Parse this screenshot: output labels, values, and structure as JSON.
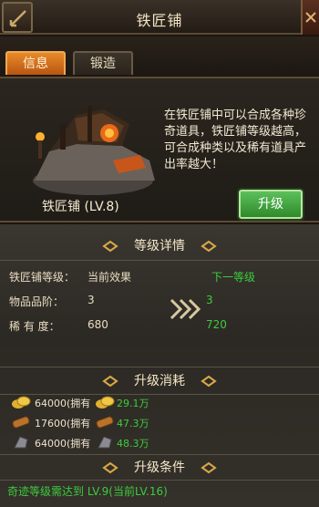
{
  "header": {
    "title": "铁匠铺",
    "back_icon": "back-arrow-icon",
    "close_icon": "close-icon"
  },
  "tabs": [
    {
      "label": "信息",
      "active": true
    },
    {
      "label": "锻造",
      "active": false
    }
  ],
  "building": {
    "name": "铁匠铺 (LV.8)",
    "description": "在铁匠铺中可以合成各种珍奇道具，铁匠铺等级越高，可合成种类以及稀有道具产出率越大！",
    "upgrade_label": "升级"
  },
  "level_details": {
    "heading": "等级详情",
    "level_label": "铁匠铺等级：",
    "current_label": "当前效果",
    "next_label": "下一等级",
    "rows": [
      {
        "label": "物品品阶：",
        "current": "3",
        "next": "3"
      },
      {
        "label": "稀 有 度：",
        "current": "680",
        "next": "720"
      }
    ]
  },
  "upgrade_cost": {
    "heading": "升级消耗",
    "items": [
      {
        "icon": "gold-coin-icon",
        "have": "64000(拥有",
        "need": "29.1万"
      },
      {
        "icon": "wood-log-icon",
        "have": "17600(拥有",
        "need": "47.3万"
      },
      {
        "icon": "iron-ore-icon",
        "have": "64000(拥有",
        "need": "48.3万"
      }
    ]
  },
  "conditions": {
    "heading": "升级条件",
    "text": "奇迹等级需达到 LV.9(当前LV.16)"
  },
  "colors": {
    "accent_orange": "#e88a2a",
    "green": "#3dcc3d",
    "button_green": "#3f9e3a"
  }
}
